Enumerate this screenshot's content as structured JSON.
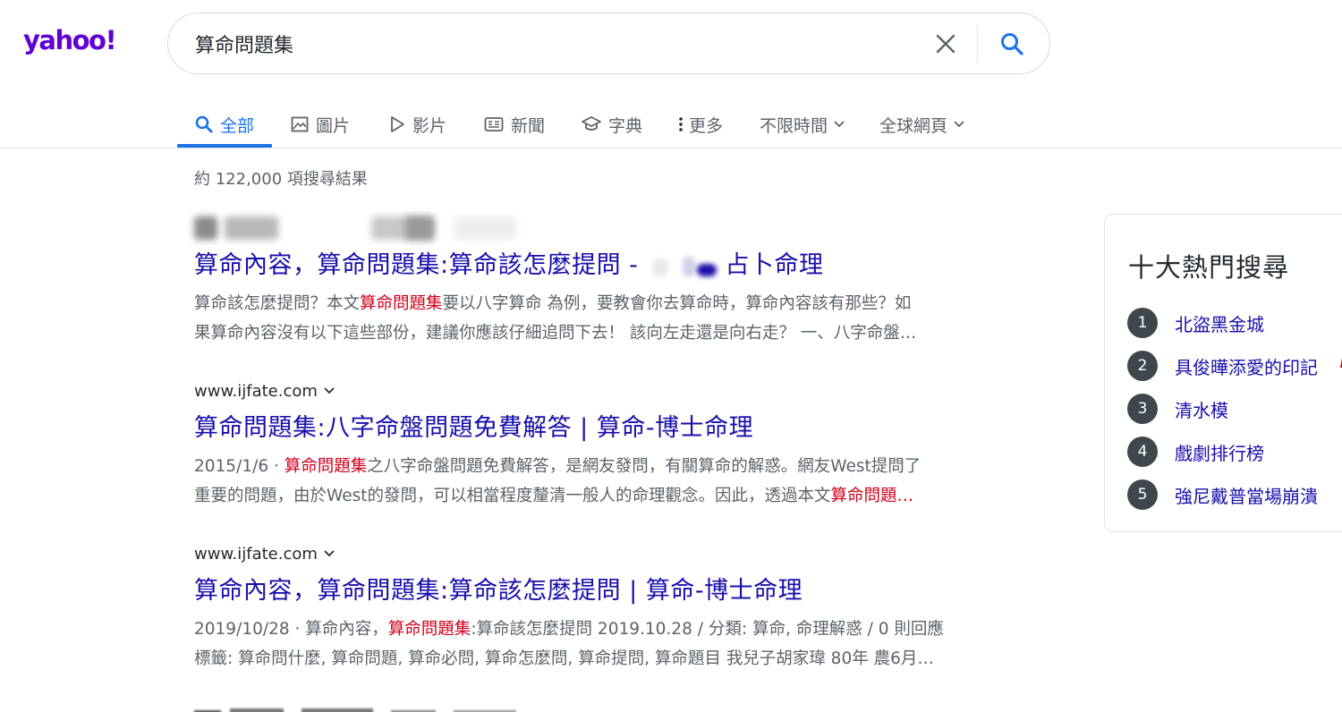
{
  "header": {
    "logo": "yahoo!",
    "search": {
      "query": "算命問題集"
    }
  },
  "tabs": [
    {
      "label": "全部",
      "icon": "search-icon",
      "active": true
    },
    {
      "label": "圖片",
      "icon": "image-icon"
    },
    {
      "label": "影片",
      "icon": "play-icon"
    },
    {
      "label": "新聞",
      "icon": "news-icon"
    },
    {
      "label": "字典",
      "icon": "graduation-cap-icon"
    },
    {
      "label": "更多",
      "icon": "more-vertical-icon"
    },
    {
      "label": "不限時間",
      "icon": "chevron-down-icon"
    },
    {
      "label": "全球網頁",
      "icon": "chevron-down-icon"
    }
  ],
  "result_count": "約 122,000 項搜尋結果",
  "results": [
    {
      "title_pre": "算命內容，算命問題集:算命該怎麼提問 - ",
      "title_post": "占卜命理",
      "snippet_line1_pre": "算命該怎麼提問？本文",
      "snippet_line1_hl": "算命問題集",
      "snippet_line1_post": "要以八字算命 為例，要教會你去算命時，算命內容該有那些？如",
      "snippet_line2": "果算命內容沒有以下這些部份，建議你應該仔細追問下去！ 該向左走還是向右走？ 一、八字命盤…"
    },
    {
      "site": "www.ijfate.com",
      "title": "算命問題集:八字命盤問題免費解答 | 算命-博士命理",
      "date": "2015/1/6 · ",
      "snippet_line1_hl": "算命問題集",
      "snippet_line1_post": "之八字命盤問題免費解答，是網友發問，有關算命的解惑。網友West提問了",
      "snippet_line2_pre": "重要的問題，由於West的發問，可以相當程度釐清一般人的命理觀念。因此，透過本文",
      "snippet_line2_hl": "算命問題…"
    },
    {
      "site": "www.ijfate.com",
      "title": "算命內容，算命問題集:算命該怎麼提問 | 算命-博士命理",
      "date": "2019/10/28 · ",
      "snippet_line1_pre": "算命內容，",
      "snippet_line1_hl": "算命問題集",
      "snippet_line1_post": ":算命該怎麼提問 2019.10.28 / 分類: 算命, 命理解惑 / 0 則回應",
      "snippet_line2": "標籤: 算命問什麼, 算命問題, 算命必問, 算命怎麼問, 算命提問, 算命題目 我兒子胡家瑋 80年 農6月…"
    }
  ],
  "trending": {
    "title": "十大熱門搜尋",
    "items": [
      {
        "rank": "1",
        "label": "北盜黑金城"
      },
      {
        "rank": "2",
        "label": "具俊曄添愛的印記"
      },
      {
        "rank": "3",
        "label": "清水模"
      },
      {
        "rank": "4",
        "label": "戲劇排行榜"
      },
      {
        "rank": "5",
        "label": "強尼戴普當場崩潰"
      }
    ]
  },
  "colors": {
    "brand": "#6001d2",
    "link": "#1a0dab",
    "highlight": "#d0021b",
    "active_tab": "#1a73e8"
  }
}
